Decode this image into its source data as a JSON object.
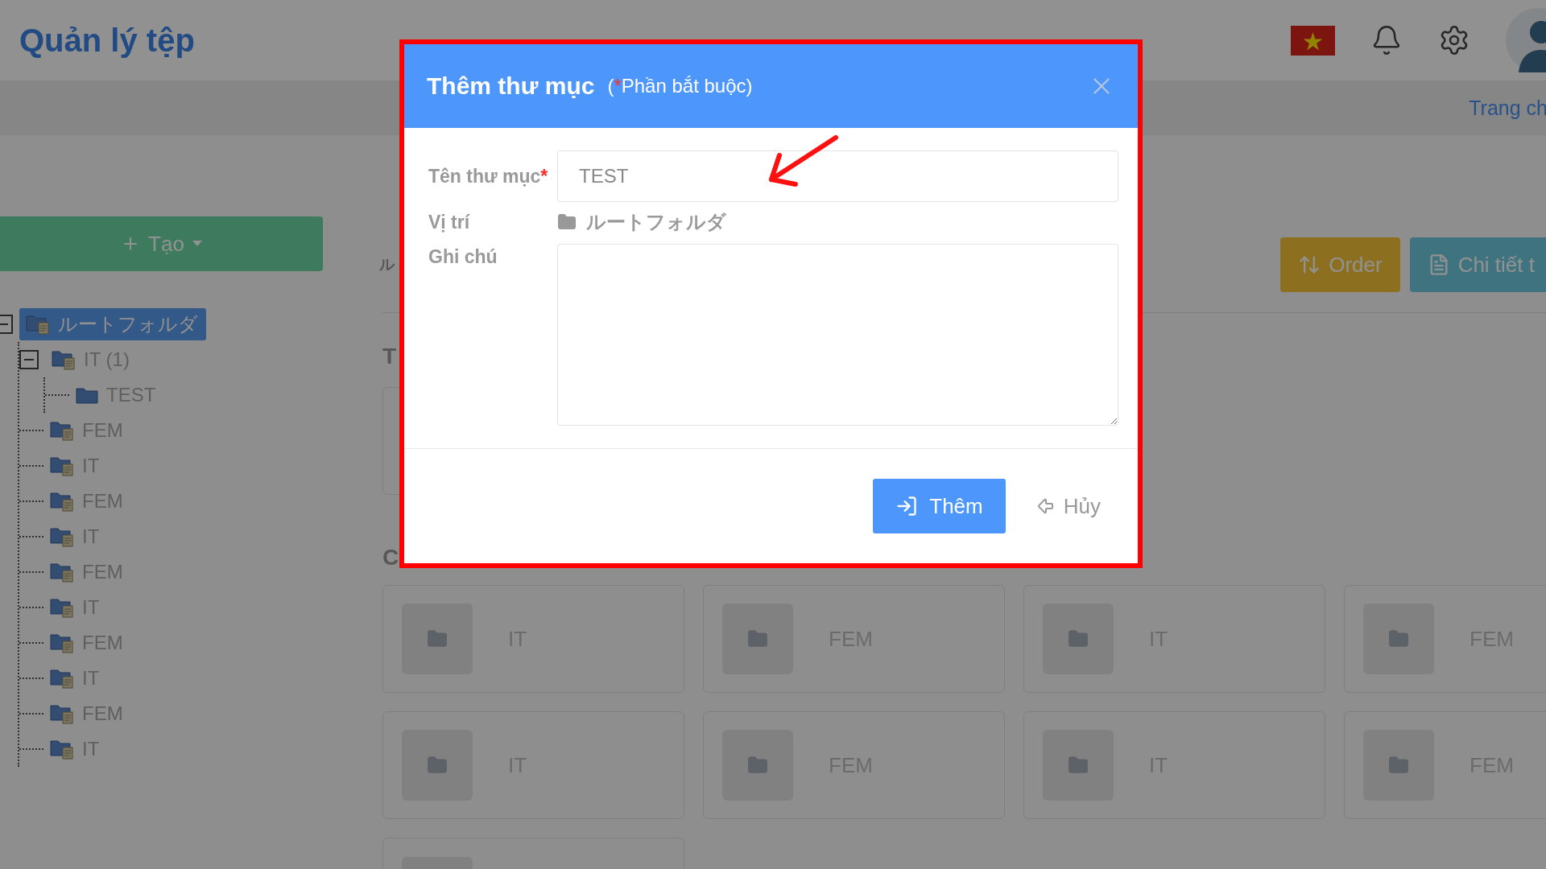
{
  "header": {
    "title": "Quản lý tệp"
  },
  "breadcrumb": "Trang ch",
  "sidebar": {
    "create_button": "Tạo",
    "tree": [
      {
        "label": "ルートフォルダ",
        "kind": "document",
        "selected": true,
        "expanded": true,
        "children": [
          {
            "label": "IT (1)",
            "kind": "document",
            "selected": false,
            "expanded": true,
            "children": [
              {
                "label": "TEST",
                "kind": "plain",
                "selected": false
              }
            ]
          },
          {
            "label": "FEM",
            "kind": "document",
            "selected": false
          },
          {
            "label": "IT",
            "kind": "document",
            "selected": false
          },
          {
            "label": "FEM",
            "kind": "document",
            "selected": false
          },
          {
            "label": "IT",
            "kind": "document",
            "selected": false
          },
          {
            "label": "FEM",
            "kind": "document",
            "selected": false
          },
          {
            "label": "IT",
            "kind": "document",
            "selected": false
          },
          {
            "label": "FEM",
            "kind": "document",
            "selected": false
          },
          {
            "label": "IT",
            "kind": "document",
            "selected": false
          },
          {
            "label": "FEM",
            "kind": "document",
            "selected": false
          },
          {
            "label": "IT",
            "kind": "document",
            "selected": false
          }
        ]
      }
    ]
  },
  "main": {
    "heading_1": "ル",
    "heading_2": "T",
    "heading_3": "C",
    "buttons": [
      {
        "label": "Order",
        "kind": "order"
      },
      {
        "label": "Chi tiết t",
        "kind": "details"
      }
    ],
    "folders": [
      {
        "label": "IT",
        "kind": "folder"
      },
      {
        "label": "FEM",
        "kind": "folder"
      },
      {
        "label": "IT",
        "kind": "folder"
      },
      {
        "label": "FEM",
        "kind": "folder"
      },
      {
        "label": "IT",
        "kind": "folder"
      },
      {
        "label": "FEM",
        "kind": "folder"
      },
      {
        "label": "IT",
        "kind": "folder"
      },
      {
        "label": "FEM",
        "kind": "folder"
      },
      {
        "kind": "blank"
      }
    ]
  },
  "dialog": {
    "title": "Thêm thư mục",
    "required_note": {
      "prefix": "(",
      "mark": "*",
      "text": "Phần bắt buộc)"
    },
    "name_field": {
      "label": "Tên thư mục",
      "required_mark": "*",
      "value": "TEST"
    },
    "location": {
      "label": "Vị trí",
      "value": "ルートフォルダ"
    },
    "note_field": {
      "label": "Ghi chú"
    },
    "submit": "Thêm",
    "cancel": "Hủy"
  }
}
